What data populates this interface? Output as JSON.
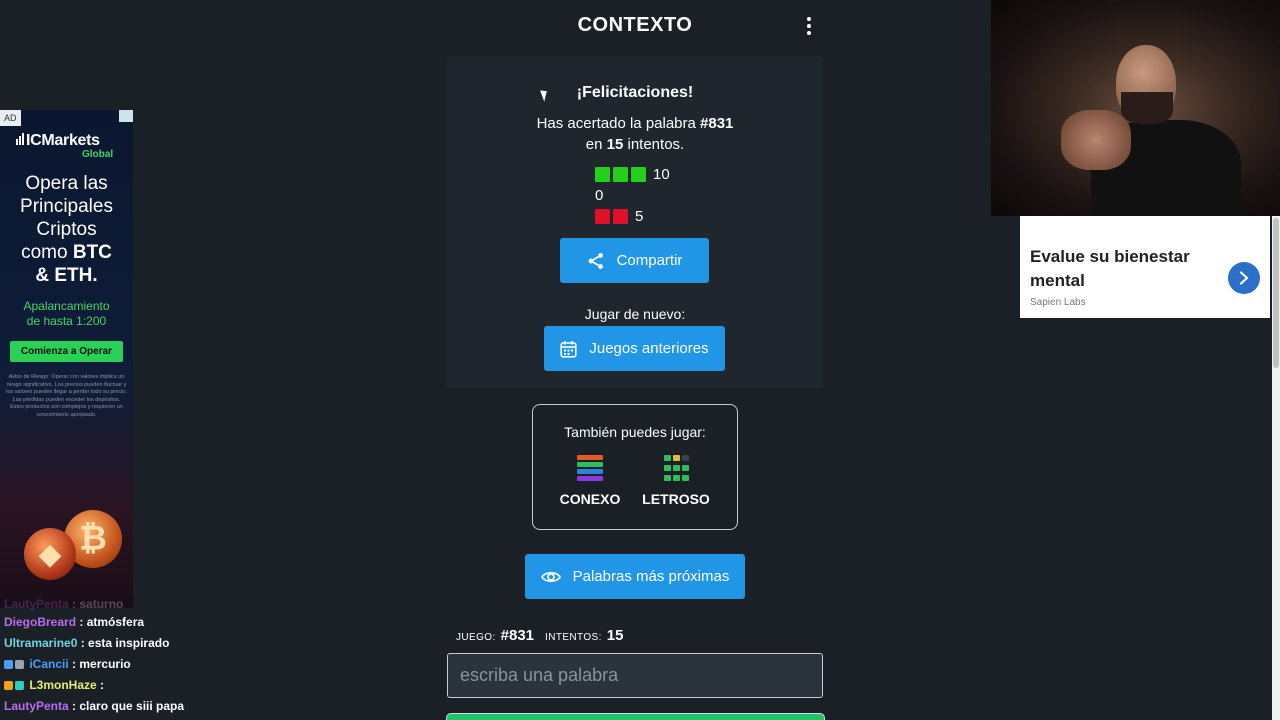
{
  "header": {
    "title": "CONTEXTO",
    "menu_icon": "more-vertical-icon"
  },
  "result": {
    "congrats": "¡Felicitaciones!",
    "line1_pre": "Has acertado la palabra ",
    "word_number": "#831",
    "line2_pre": "en ",
    "attempts": "15",
    "line2_post": " intentos.",
    "distribution": [
      {
        "color": "#23d11a",
        "squares": 3,
        "count": "10"
      },
      {
        "color": "#f0c419",
        "squares": 0,
        "count": "0"
      },
      {
        "color": "#e0102a",
        "squares": 2,
        "count": "5"
      }
    ],
    "share_label": "Compartir",
    "share_icon": "share-icon",
    "play_again": "Jugar de nuevo:",
    "previous_label": "Juegos anteriores",
    "previous_icon": "calendar-icon"
  },
  "also_play": {
    "title": "También puedes jugar:",
    "games": [
      {
        "label": "CONEXO"
      },
      {
        "label": "LETROSO"
      }
    ]
  },
  "nearest": {
    "label": "Palabras más próximas",
    "icon": "eye-icon"
  },
  "game_info": {
    "game_label": "JUEGO:",
    "game_value": "#831",
    "attempts_label": "INTENTOS:",
    "attempts_value": "15"
  },
  "input": {
    "placeholder": "escriba una palabra"
  },
  "left_ad": {
    "badge": "AD",
    "brand": "ICMarkets",
    "brand_sub": "Global",
    "headline_1": "Opera las",
    "headline_2": "Principales",
    "headline_3": "Criptos",
    "headline_4": "como ",
    "headline_4b": "BTC",
    "headline_5": "& ETH.",
    "sub_1": "Apalancamiento",
    "sub_2": "de hasta 1:200",
    "cta": "Comienza a Operar",
    "disclaimer": "Aviso de Riesgo: Operar con valores implica un riesgo significativo. Los precios pueden fluctuar y los valores pueden llegar a perder todo su precio. Las pérdidas pueden exceder los depósitos. Estos productos son complejos y requieren un conocimiento apropiado."
  },
  "chat": [
    {
      "user": "LautyPenta",
      "msg": ": saturno",
      "color": "#b86cf0",
      "faded": true
    },
    {
      "user": "DiegoBreard",
      "msg": ": atmósfera",
      "color": "#b86cf0"
    },
    {
      "user": "Ultramarine0",
      "msg": ": esta inspirado",
      "color": "#6fd4e0"
    },
    {
      "user": "iCancii",
      "msg": ": mercurio",
      "color": "#4b9df5",
      "badge": "#4b9df5"
    },
    {
      "user": "L3monHaze",
      "msg": ": ",
      "color": "#e3f06a",
      "badge": "#f0a21b"
    },
    {
      "user": "LautyPenta",
      "msg": ": claro que siii papa",
      "color": "#b86cf0"
    }
  ],
  "right_ad": {
    "title": "Evalue su bienestar mental",
    "source": "Sapien Labs",
    "arrow_icon": "chevron-right-icon"
  },
  "colors": {
    "background": "#1b2027",
    "card": "#20262e",
    "accent": "#2196e7",
    "green": "#23d11a",
    "red": "#e0102a"
  }
}
